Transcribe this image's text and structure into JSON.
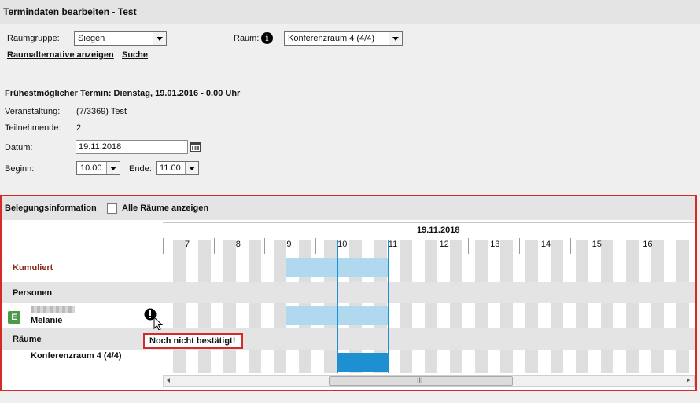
{
  "window": {
    "title": "Termindaten bearbeiten - Test"
  },
  "form": {
    "raumgruppe_label": "Raumgruppe:",
    "raumgruppe_value": "Siegen",
    "raum_label": "Raum:",
    "raum_value": "Konferenzraum 4 (4/4)",
    "raumalternative_link": "Raumalternative anzeigen",
    "suche_link": "Suche",
    "earliest": "Frühestmöglicher Termin: Dienstag, 19.01.2016 - 0.00 Uhr",
    "veranstaltung_label": "Veranstaltung:",
    "veranstaltung_value": "(7/3369) Test",
    "teilnehmende_label": "Teilnehmende:",
    "teilnehmende_value": "2",
    "datum_label": "Datum:",
    "datum_value": "19.11.2018",
    "beginn_label": "Beginn:",
    "beginn_value": "10.00",
    "ende_label": "Ende:",
    "ende_value": "11.00"
  },
  "belegung": {
    "title": "Belegungsinformation",
    "checkbox_label": "Alle Räume anzeigen",
    "checkbox_checked": false,
    "date": "19.11.2018",
    "hours": [
      "7",
      "8",
      "9",
      "10",
      "11",
      "12",
      "13",
      "14",
      "15",
      "16"
    ],
    "rows": {
      "kumuliert": "Kumuliert",
      "personen": "Personen",
      "person_badge": "E",
      "person_name": "Melanie",
      "raeume": "Räume",
      "room_name": "Konferenzraum 4 (4/4)"
    },
    "tooltip": "Noch nicht bestätigt!",
    "scrollbar_grip": "III",
    "colors": {
      "accent_red": "#d42a2a",
      "kumuliert_text": "#8b2a1a",
      "light_bar": "#b0d8ee",
      "room_bar": "#1e8fd0",
      "badge_green": "#4a9a4a"
    }
  }
}
